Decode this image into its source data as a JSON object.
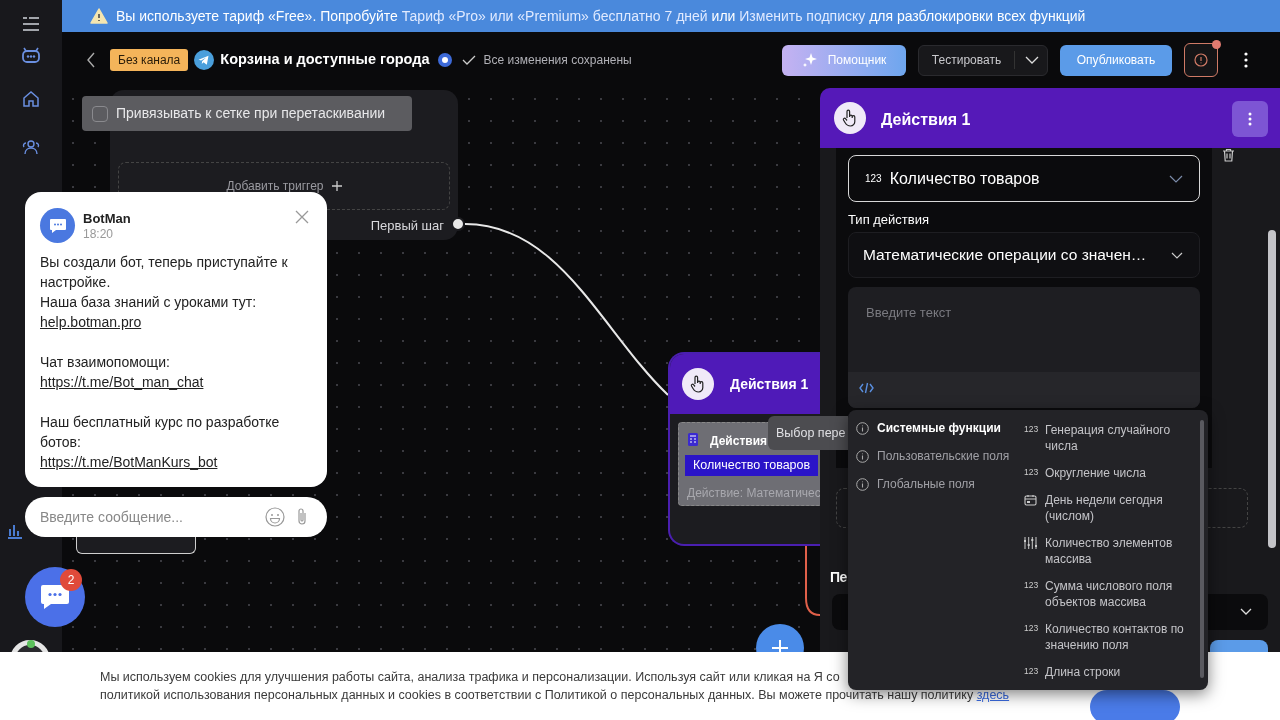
{
  "banner": {
    "parts": [
      {
        "kind": "text",
        "text": "Вы используете тариф «Free». Попробуйте"
      },
      {
        "kind": "link",
        "text": "Тариф «Pro» или «Premium» бесплатно 7 дней"
      },
      {
        "kind": "text",
        "text": "или"
      },
      {
        "kind": "link",
        "text": "Изменить подписку"
      },
      {
        "kind": "text",
        "text": "для разблокировки всех функций"
      }
    ]
  },
  "header": {
    "channel_badge": "Без канала",
    "bot_title": "Корзина и доступные города",
    "save_status": "Все изменения сохранены",
    "assistant_button": "Помощник",
    "test_button": "Тестировать",
    "publish_button": "Опубликовать"
  },
  "canvas": {
    "snap_to_grid": {
      "label": "Привязывать к сетке при перетаскивании",
      "checked": false
    },
    "start_node": {
      "add_trigger": "Добавить триггер",
      "first_step": "Первый шаг"
    },
    "action_node": {
      "title": "Действия 1",
      "block_title": "Действия",
      "variable": "Количество товаров",
      "summary": "Действие: Математичес"
    },
    "tooltip": "Выбор пере"
  },
  "panel": {
    "title": "Действия 1",
    "variable_select": {
      "type_icon": "123",
      "value": "Количество товаров"
    },
    "action_type_label": "Тип действия",
    "action_type_select": "Математические операции со значен…",
    "text_field": {
      "placeholder": "Введите текст"
    },
    "section_heading": "Пе"
  },
  "dropdown": {
    "categories": [
      {
        "label": "Системные функции",
        "selected": true
      },
      {
        "label": "Пользовательские поля",
        "selected": false
      },
      {
        "label": "Глобальные поля",
        "selected": false
      }
    ],
    "functions": [
      {
        "kind": "number",
        "icon_text": "123",
        "label": "Генерация случайного числа"
      },
      {
        "kind": "number",
        "icon_text": "123",
        "label": "Округление числа"
      },
      {
        "kind": "calendar",
        "label": "День недели сегодня (числом)"
      },
      {
        "kind": "array",
        "label": "Количество элементов массива"
      },
      {
        "kind": "number",
        "icon_text": "123",
        "label": "Сумма числового поля объектов массива"
      },
      {
        "kind": "number",
        "icon_text": "123",
        "label": "Количество контактов по значению поля"
      },
      {
        "kind": "number",
        "icon_text": "123",
        "label": "Длина строки"
      }
    ]
  },
  "chat_widget": {
    "sender": "BotMan",
    "time": "18:20",
    "blocks": [
      {
        "lines": [
          {
            "kind": "text",
            "text": "Вы создали бот, теперь приступайте к настройке."
          },
          {
            "kind": "text",
            "text": "Наша база знаний с уроками тут:"
          },
          {
            "kind": "link",
            "text": "help.botman.pro"
          }
        ]
      },
      {
        "lines": [
          {
            "kind": "text",
            "text": "Чат взаимопомощи:"
          },
          {
            "kind": "link",
            "text": "https://t.me/Bot_man_chat"
          }
        ]
      },
      {
        "lines": [
          {
            "kind": "text",
            "text": "Наш бесплатный курс по разработке ботов:"
          },
          {
            "kind": "link",
            "text": "https://t.me/BotManKurs_bot"
          }
        ]
      }
    ],
    "input": {
      "placeholder": "Введите сообщение..."
    },
    "unread_count": "2"
  },
  "cookie_banner": {
    "lines": [
      "Мы используем cookies для улучшения работы сайта, анализа трафика и персонализации. Используя сайт или кликая на Я со",
      "политикой использования персональных данных и cookies в соответствии с Политикой о персональных данных. Вы можете прочитать нашу политику"
    ],
    "link": "здесь"
  }
}
